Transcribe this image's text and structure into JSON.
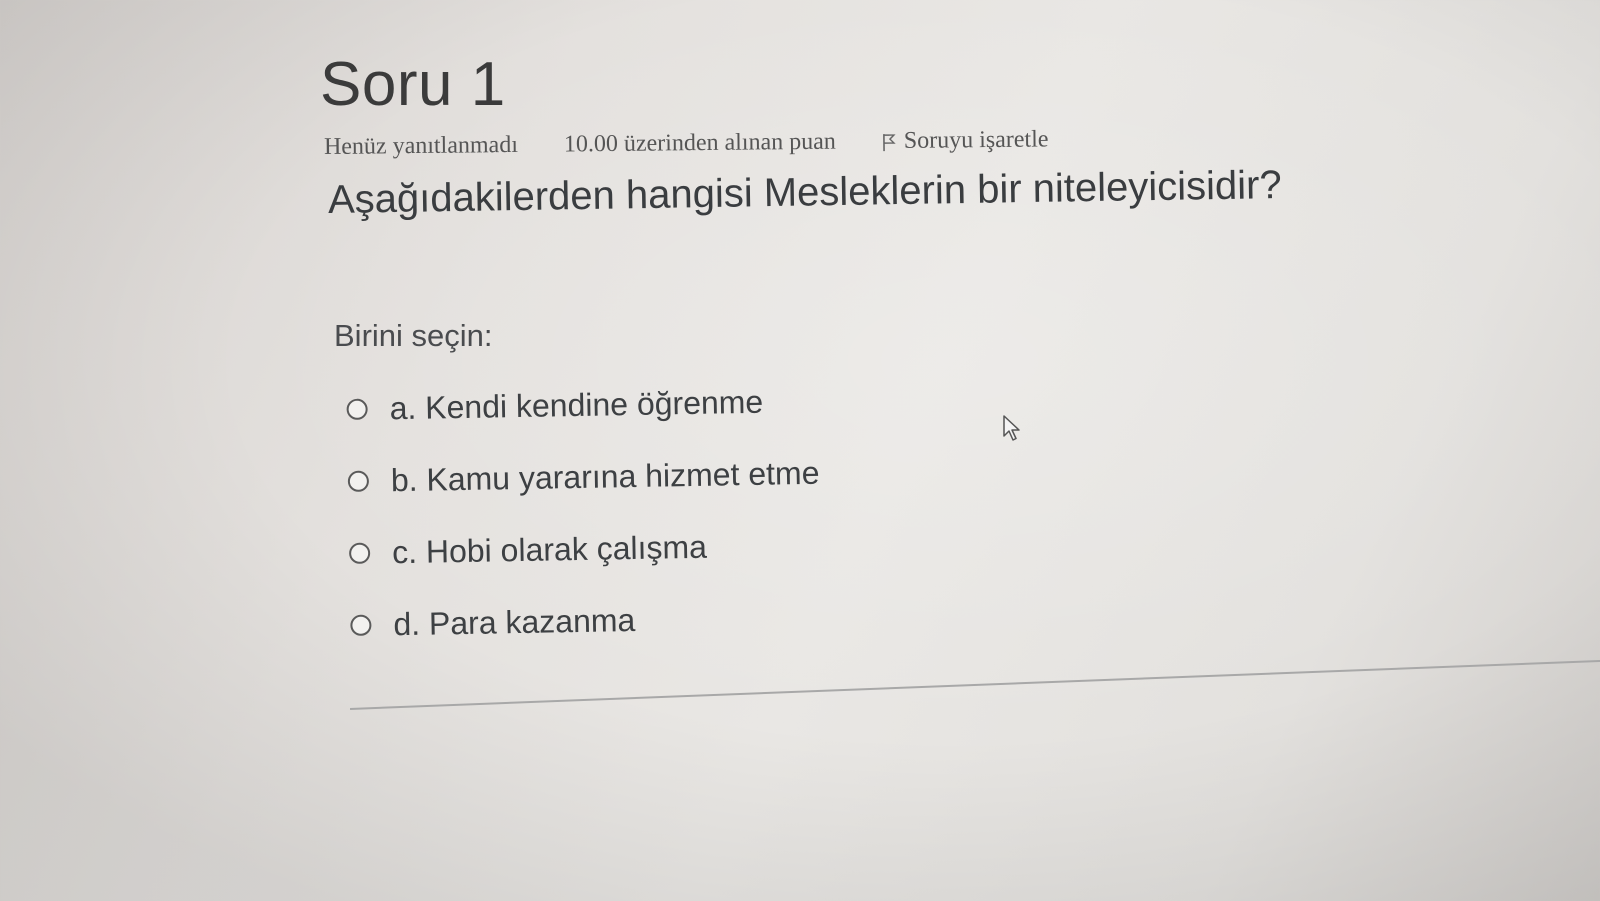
{
  "question": {
    "number_label": "Soru 1",
    "status": "Henüz yanıtlanmadı",
    "points": "10.00 üzerinden alınan puan",
    "flag_label": "Soruyu işaretle",
    "flag_icon": "flag-icon",
    "text": "Aşağıdakilerden hangisi Mesleklerin bir niteleyicisidir?",
    "prompt": "Birini seçin:",
    "options": [
      {
        "letter": "a.",
        "label": "a. Kendi kendine öğrenme",
        "selected": false
      },
      {
        "letter": "b.",
        "label": "b. Kamu yararına hizmet etme",
        "selected": false
      },
      {
        "letter": "c.",
        "label": "c. Hobi olarak çalışma",
        "selected": false
      },
      {
        "letter": "d.",
        "label": "d. Para kazanma",
        "selected": false
      }
    ]
  },
  "colors": {
    "text": "#3a3a3a",
    "meta_text": "#555555",
    "background": "#e6e4e1"
  }
}
